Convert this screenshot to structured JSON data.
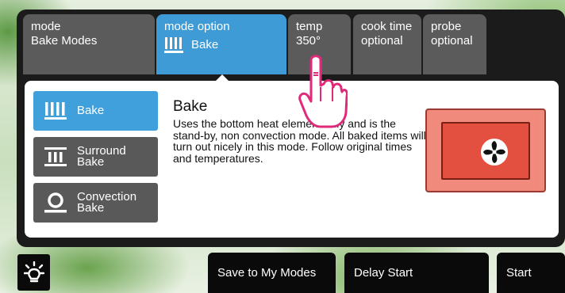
{
  "tabs": [
    {
      "line1": "mode",
      "line2": "Bake Modes"
    },
    {
      "line1": "mode option",
      "line2": "Bake"
    },
    {
      "line1": "temp",
      "line2": "350°"
    },
    {
      "line1": "cook time",
      "line2": "optional"
    },
    {
      "line1": "probe",
      "line2": "optional"
    }
  ],
  "options": [
    {
      "label": "Bake"
    },
    {
      "label_line1": "Surround",
      "label_line2": "Bake"
    },
    {
      "label_line1": "Convection",
      "label_line2": "Bake"
    }
  ],
  "detail": {
    "title": "Bake",
    "description": "Uses the bottom heat element only and is the stand-by, non convection mode. All baked items will turn out nicely in this mode. Follow original times and temperatures."
  },
  "bottom": {
    "save": "Save to My Modes",
    "delay": "Delay Start",
    "start": "Start"
  },
  "colors": {
    "active_tab": "#3f9bd6",
    "inactive_tab": "#5b5b5b",
    "oven_fill": "#f08a7d",
    "hand": "#e0297a"
  },
  "icons": [
    "bake-icon",
    "surround-bake-icon",
    "convection-bake-icon",
    "fan-icon",
    "light-bulb-icon",
    "pointing-hand-icon"
  ]
}
